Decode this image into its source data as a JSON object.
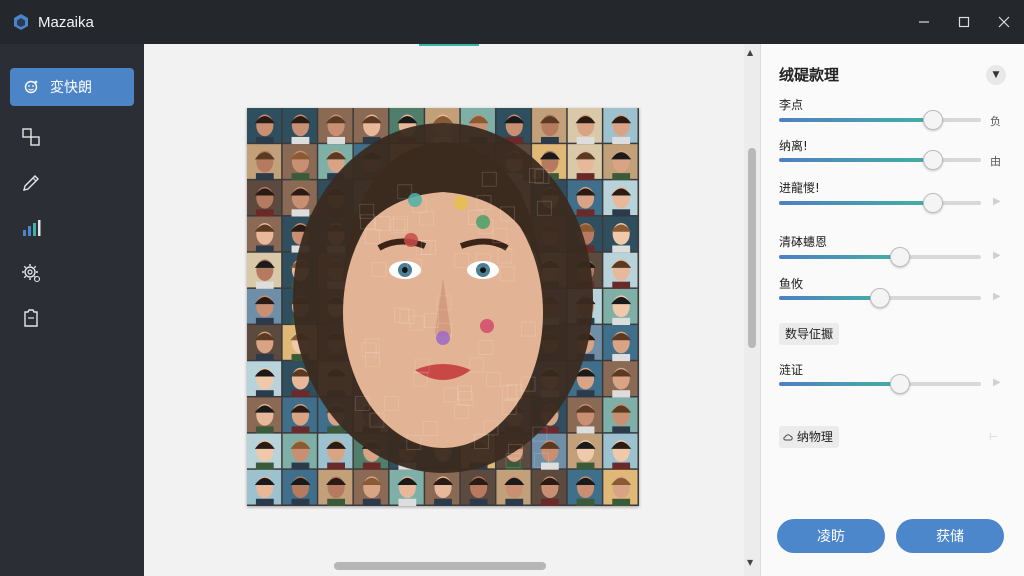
{
  "app": {
    "title": "Mazaika"
  },
  "sidebar": {
    "active_item": {
      "label": "変快朗",
      "icon": "face-retouch-icon"
    },
    "items": [
      {
        "name": "shapes-icon"
      },
      {
        "name": "pencil-icon"
      },
      {
        "name": "bar-chart-icon"
      },
      {
        "name": "gear-icon"
      },
      {
        "name": "clipboard-icon"
      }
    ]
  },
  "panel": {
    "title": "绒碮款理",
    "controls": [
      {
        "label": "李点",
        "level": 0.76,
        "glyph": "负"
      },
      {
        "label": "纳离!",
        "level": 0.76,
        "glyph": "由"
      },
      {
        "label": "进龍惾!",
        "level": 0.76,
        "glyph": ""
      },
      {
        "label": "清砵蟪恩",
        "level": 0.6,
        "glyph": ""
      },
      {
        "label": "鱼攸",
        "level": 0.5,
        "glyph": ""
      },
      {
        "label": "涟证",
        "level": 0.6,
        "glyph": ""
      }
    ],
    "chip1": "数导佂擫",
    "chip2": "纳物理",
    "buttons": {
      "primary": "凌眆",
      "secondary": "获储"
    }
  },
  "colors": {
    "accent": "#4c84c8",
    "slider_end": "#43b0a4",
    "titlebar": "#24272c",
    "sidebar": "#2b2e34"
  }
}
